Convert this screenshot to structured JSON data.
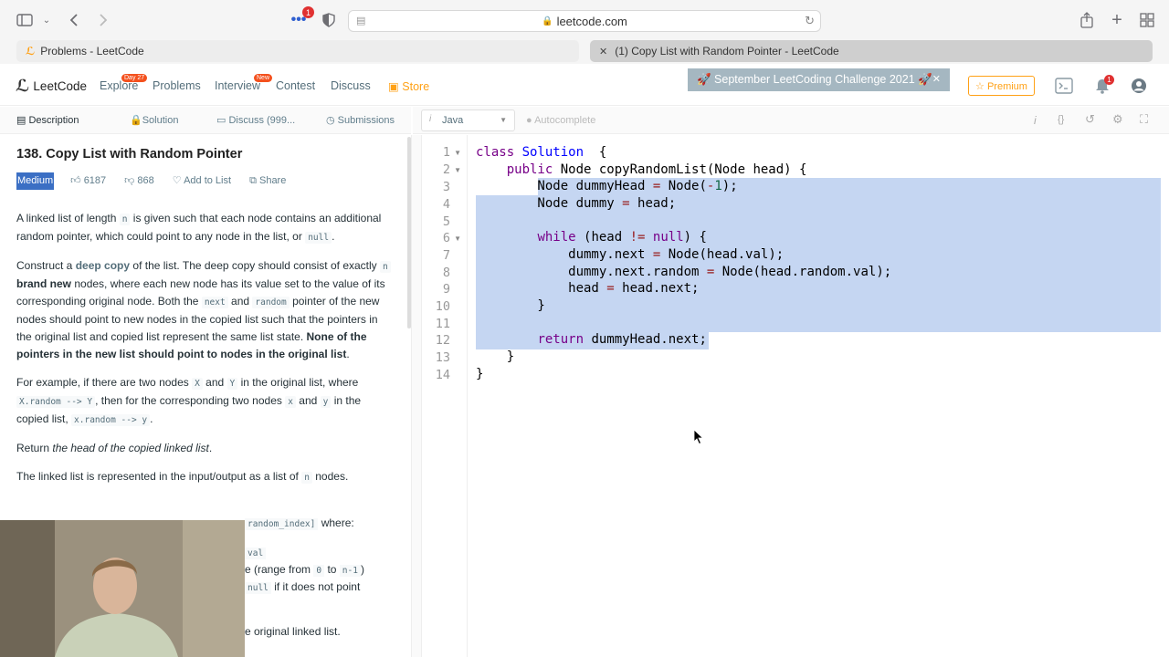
{
  "browser": {
    "url": "leetcode.com",
    "extension_badge": "1",
    "tabs": [
      {
        "title": "Problems - LeetCode"
      },
      {
        "title": "(1) Copy List with Random Pointer - LeetCode"
      }
    ]
  },
  "nav": {
    "logo": "LeetCode",
    "links": [
      {
        "label": "Explore",
        "badge": "Day 27"
      },
      {
        "label": "Problems",
        "badge": ""
      },
      {
        "label": "Interview",
        "badge": "New"
      },
      {
        "label": "Contest",
        "badge": ""
      },
      {
        "label": "Discuss",
        "badge": ""
      },
      {
        "label": "Store",
        "badge": ""
      }
    ],
    "challenge_banner": "🚀 September LeetCoding Challenge 2021 🚀",
    "premium": "☆ Premium",
    "notification_count": "1"
  },
  "left_tabs": [
    "Description",
    "Solution",
    "Discuss (999...",
    "Submissions"
  ],
  "problem": {
    "title": "138. Copy List with Random Pointer",
    "difficulty": "Medium",
    "likes": "6187",
    "dislikes": "868",
    "add_to_list": "Add to List",
    "share": "Share",
    "p1_a": "A linked list of length ",
    "p1_code": "n",
    "p1_b": " is given such that each node contains an additional random pointer, which could point to any node in the list, or ",
    "p1_null": "null",
    "p1_end": ".",
    "p2_a": "Construct a ",
    "p2_deep": "deep copy",
    "p2_b": " of the list. The deep copy should consist of exactly ",
    "p2_n": "n",
    "p2_brand": " brand new",
    "p2_c": " nodes, where each new node has its value set to the value of its corresponding original node. Both the ",
    "p2_next": "next",
    "p2_and": " and ",
    "p2_random": "random",
    "p2_d": " pointer of the new nodes should point to new nodes in the copied list such that the pointers in the original list and copied list represent the same list state. ",
    "p2_bold": "None of the pointers in the new list should point to nodes in the original list",
    "p2_end": ".",
    "p3_a": "For example, if there are two nodes ",
    "p3_X": "X",
    "p3_and1": " and ",
    "p3_Y": "Y",
    "p3_b": " in the original list, where ",
    "p3_xr": "X.random --> Y",
    "p3_c": ", then for the corresponding two nodes ",
    "p3_x": "x",
    "p3_and2": " and ",
    "p3_y": "y",
    "p3_d": " in the copied list, ",
    "p3_xr2": "x.random --> y",
    "p3_end": ".",
    "p4_a": "Return ",
    "p4_em": "the head of the copied linked list",
    "p4_end": ".",
    "p5_a": "The linked list is represented in the input/output as a list of ",
    "p5_n": "n",
    "p5_end": " nodes.",
    "frag1_code": "random_index]",
    "frag1_text": " where:",
    "frag2_code": "val",
    "frag3_a": "e (range from ",
    "frag3_0": "0",
    "frag3_to": " to ",
    "frag3_n1": "n-1",
    "frag3_end": ")",
    "frag4_code": "null",
    "frag4_text": " if it does not point",
    "frag5_text": "e original linked list."
  },
  "editor": {
    "language": "Java",
    "autocomplete": "Autocomplete",
    "line_numbers": [
      "1",
      "2",
      "3",
      "4",
      "5",
      "6",
      "7",
      "8",
      "9",
      "10",
      "11",
      "12",
      "13",
      "14"
    ]
  }
}
